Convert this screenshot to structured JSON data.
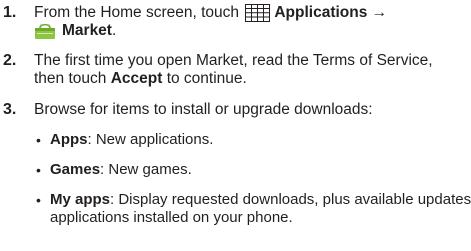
{
  "steps": [
    {
      "number": "1.",
      "line1_prefix": "From the Home screen, touch",
      "line1_label": "Applications →",
      "line2_label": "Market",
      "line2_suffix": ".",
      "icons": [
        "applications-grid-icon",
        "market-bag-icon"
      ]
    },
    {
      "number": "2.",
      "line1": "The first time you open Market, read the Terms of Service,",
      "line2_prefix": "then touch ",
      "line2_bold": "Accept",
      "line2_suffix": " to continue."
    },
    {
      "number": "3.",
      "line1": "Browse for items to install or upgrade downloads:"
    }
  ],
  "bullets": [
    {
      "bullet": "•",
      "label": "Apps",
      "text": ": New applications."
    },
    {
      "bullet": "•",
      "label": "Games",
      "text": ": New games."
    },
    {
      "bullet": "•",
      "label": "My apps",
      "text": ": Display requested downloads, plus available updates to",
      "line2": "applications installed on your phone."
    }
  ],
  "colors": {
    "text": "#231f20",
    "icon_green": "#8cc63f",
    "icon_grid": "#231f20"
  }
}
